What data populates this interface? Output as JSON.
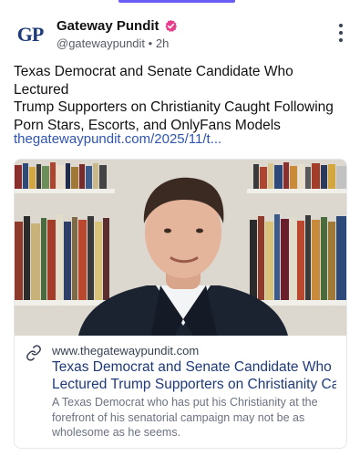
{
  "post": {
    "author": {
      "avatar_text": "GP",
      "display_name": "Gateway Pundit",
      "handle": "@gatewaypundit",
      "separator": "•",
      "time": "2h",
      "verified_color": "#e83e8c"
    },
    "text_lines": [
      "Texas Democrat and Senate Candidate Who Lectured",
      "Trump Supporters on Christianity Caught Following",
      "Porn Stars, Escorts, and OnlyFans Models"
    ],
    "link": "thegatewaypundit.com/2025/11/t..."
  },
  "link_card": {
    "domain": "www.thegatewaypundit.com",
    "title_lines": [
      "Texas Democrat and Senate Candidate Who",
      "Lectured Trump Supporters on Christianity Ca..."
    ],
    "description_lines": [
      "A Texas Democrat who has put his Christianity at the",
      "forefront of his senatorial campaign may not be as",
      "wholesome as he seems."
    ]
  },
  "colors": {
    "accent": "#6b5cf6",
    "link": "#2f55b3",
    "card_title": "#1f3a7a",
    "brand_navy": "#1f3a7a"
  },
  "icons": {
    "verified": "verified-badge-icon",
    "more": "more-vertical-icon",
    "link": "link-icon"
  }
}
